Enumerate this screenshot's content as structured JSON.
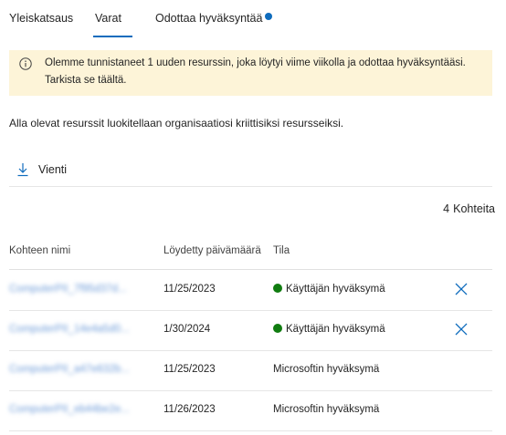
{
  "tabs": [
    {
      "label": "Yleiskatsaus",
      "selected": false
    },
    {
      "label": "Varat",
      "selected": true
    },
    {
      "label": "Odottaa hyväksyntää",
      "selected": false,
      "badge_dot": true
    }
  ],
  "banner": {
    "icon": "info-icon",
    "line1": "Olemme tunnistaneet 1 uuden resurssin, joka löytyi viime viikolla ja odottaa hyväksyntääsi.",
    "line2": "Tarkista se täältä."
  },
  "description": "Alla olevat resurssit luokitellaan organisaatiosi kriittisiksi resursseiksi.",
  "toolbar": {
    "export_label": "Vienti",
    "export_icon": "download-icon"
  },
  "count": {
    "number": "4",
    "label": "Kohteita"
  },
  "table": {
    "headers": [
      "Kohteen nimi",
      "Löydetty päivämäärä",
      "Tila"
    ],
    "rows": [
      {
        "name": "ComputerPII_7f95d37d...",
        "date": "11/25/2023",
        "status": "Käyttäjän hyväksymä",
        "status_dot": true,
        "removable": true
      },
      {
        "name": "ComputerPII_14e4a5d0...",
        "date": "1/30/2024",
        "status": "Käyttäjän hyväksymä",
        "status_dot": true,
        "removable": true
      },
      {
        "name": "ComputerPII_a47e632b...",
        "date": "11/25/2023",
        "status": "Microsoftin hyväksymä",
        "status_dot": false,
        "removable": false
      },
      {
        "name": "ComputerPII_eb44be2e...",
        "date": "11/26/2023",
        "status": "Microsoftin hyväksymä",
        "status_dot": false,
        "removable": false
      }
    ]
  },
  "colors": {
    "accent": "#0f6cbd",
    "banner_bg": "#fdf4d8",
    "approved_dot": "#107c10"
  }
}
